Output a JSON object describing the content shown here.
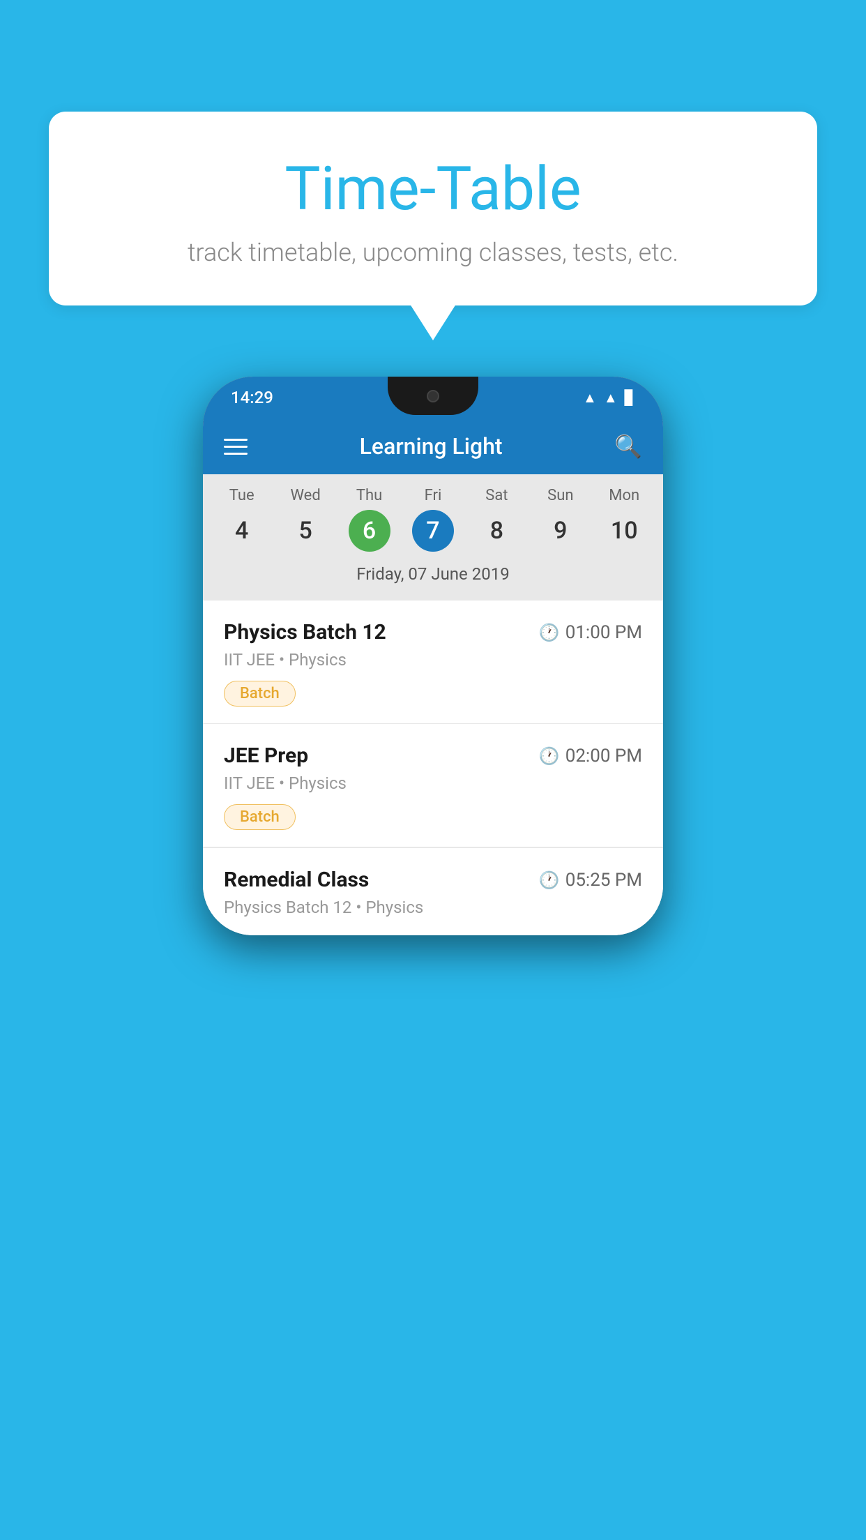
{
  "background": {
    "color": "#29b6e8"
  },
  "speech_bubble": {
    "title": "Time-Table",
    "subtitle": "track timetable, upcoming classes, tests, etc."
  },
  "phone": {
    "status_bar": {
      "time": "14:29",
      "icons": [
        "wifi",
        "signal",
        "battery"
      ]
    },
    "app_bar": {
      "title": "Learning Light",
      "menu_icon": "hamburger",
      "search_icon": "search"
    },
    "calendar": {
      "days": [
        {
          "name": "Tue",
          "num": "4",
          "state": "normal"
        },
        {
          "name": "Wed",
          "num": "5",
          "state": "normal"
        },
        {
          "name": "Thu",
          "num": "6",
          "state": "today"
        },
        {
          "name": "Fri",
          "num": "7",
          "state": "selected"
        },
        {
          "name": "Sat",
          "num": "8",
          "state": "normal"
        },
        {
          "name": "Sun",
          "num": "9",
          "state": "normal"
        },
        {
          "name": "Mon",
          "num": "10",
          "state": "normal"
        }
      ],
      "selected_date_label": "Friday, 07 June 2019"
    },
    "schedule_items": [
      {
        "title": "Physics Batch 12",
        "time": "01:00 PM",
        "meta": "IIT JEE • Physics",
        "badge": "Batch"
      },
      {
        "title": "JEE Prep",
        "time": "02:00 PM",
        "meta": "IIT JEE • Physics",
        "badge": "Batch"
      },
      {
        "title": "Remedial Class",
        "time": "05:25 PM",
        "meta": "Physics Batch 12 • Physics",
        "badge": null
      }
    ]
  }
}
